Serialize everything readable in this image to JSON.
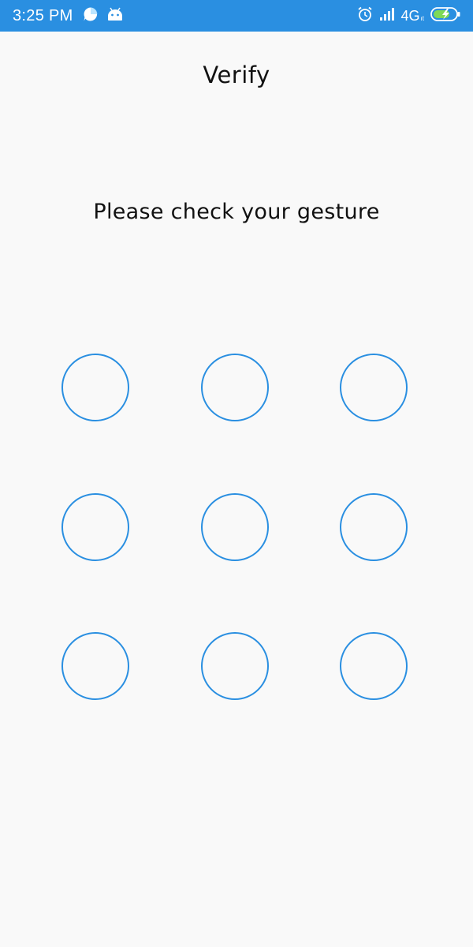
{
  "status_bar": {
    "time": "3:25 PM",
    "network": "4G",
    "network_sub": "ıt",
    "icons_left": [
      "chat-bubble-icon",
      "android-icon"
    ],
    "icons_right": [
      "alarm-icon",
      "signal-icon",
      "battery-charging-icon"
    ],
    "background_color": "#2a8fe1"
  },
  "header": {
    "title": "Verify"
  },
  "main": {
    "prompt": "Please check your gesture",
    "gesture_grid": {
      "rows": 3,
      "cols": 3,
      "dot_color": "#2a8fe1"
    }
  }
}
